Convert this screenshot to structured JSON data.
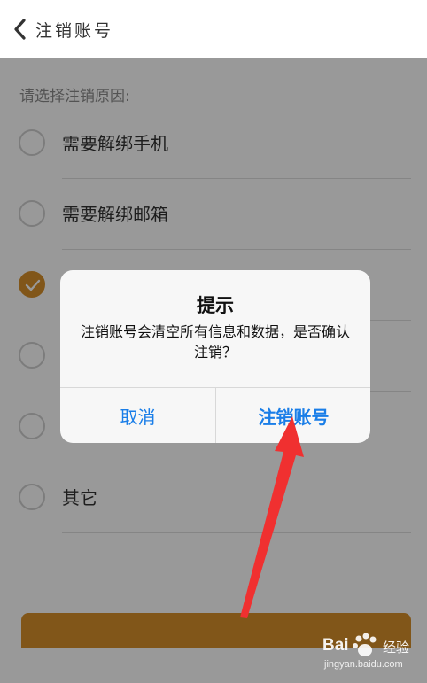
{
  "header": {
    "back_icon": "chevron-left-icon",
    "title": "注销账号"
  },
  "form": {
    "section_label": "请选择注销原因:",
    "options": [
      {
        "label": "需要解绑手机",
        "checked": false
      },
      {
        "label": "需要解绑邮箱",
        "checked": false
      },
      {
        "label": "",
        "checked": true
      },
      {
        "label": "",
        "checked": false
      },
      {
        "label": "",
        "checked": false
      },
      {
        "label": "其它",
        "checked": false
      }
    ]
  },
  "dialog": {
    "title": "提示",
    "message": "注销账号会清空所有信息和数据，是否确认注销？",
    "cancel_label": "取消",
    "confirm_label": "注销账号"
  },
  "colors": {
    "accent": "#d7902a",
    "dialog_button": "#1a7ee8",
    "annotation_arrow": "#f03030"
  },
  "watermark": {
    "brand": "Bai",
    "suffix": "经验",
    "url": "jingyan.baidu.com"
  }
}
